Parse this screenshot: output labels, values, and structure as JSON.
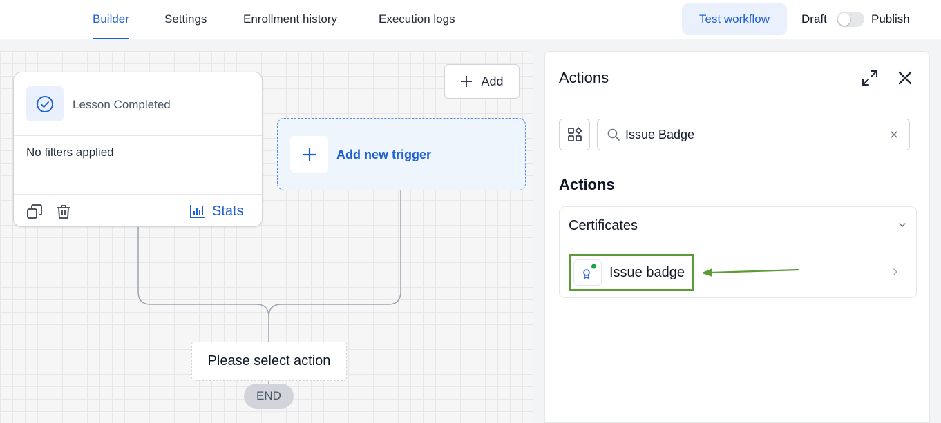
{
  "topbar": {
    "tabs": [
      {
        "label": "Builder",
        "active": true
      },
      {
        "label": "Settings",
        "active": false
      },
      {
        "label": "Enrollment history",
        "active": false
      },
      {
        "label": "Execution logs",
        "active": false
      }
    ],
    "test_workflow": "Test workflow",
    "draft_label": "Draft",
    "publish_label": "Publish",
    "publish_toggle_on": false
  },
  "canvas": {
    "trigger": {
      "title": "Lesson Completed",
      "filters": "No filters applied",
      "stats_label": "Stats"
    },
    "add_button": "Add",
    "new_trigger": "Add new trigger",
    "select_action": "Please select action",
    "end_label": "END"
  },
  "panel": {
    "title": "Actions",
    "search": {
      "value": "Issue Badge"
    },
    "section_heading": "Actions",
    "category": {
      "label": "Certificates",
      "items": [
        {
          "label": "Issue badge"
        }
      ]
    }
  },
  "colors": {
    "accent": "#1d5fd6",
    "highlight": "#5c9b35",
    "status_dot": "#16a34a"
  }
}
